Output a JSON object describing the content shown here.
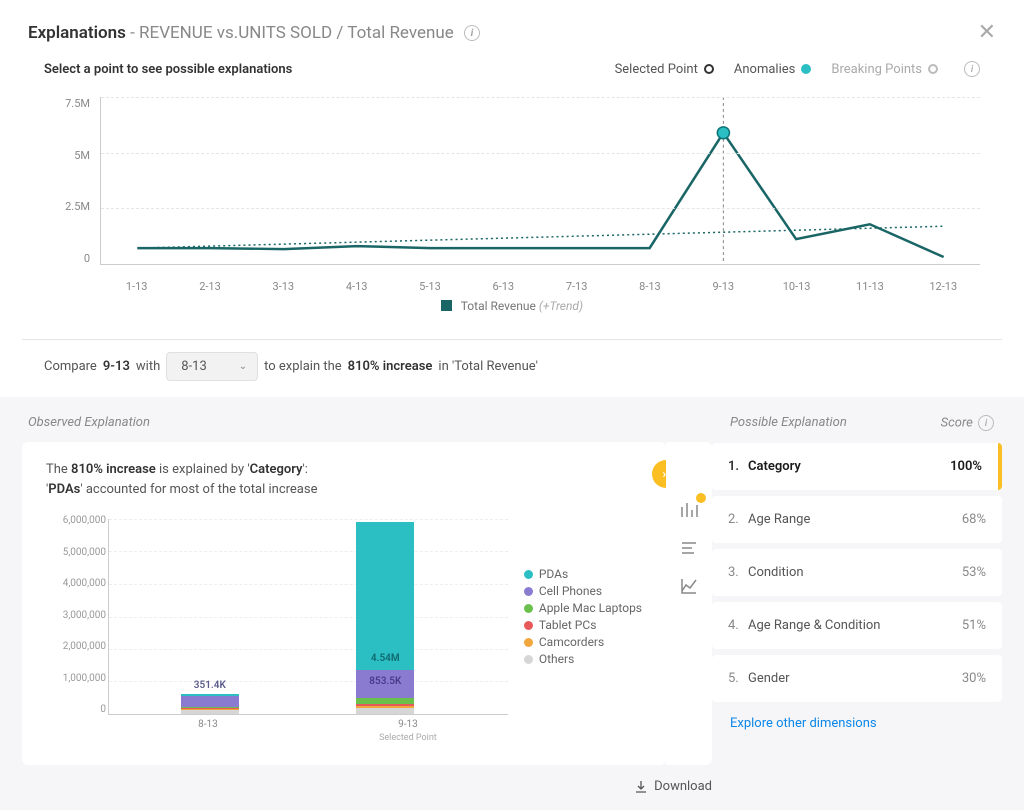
{
  "header": {
    "title_main": "Explanations",
    "title_sub": " - REVENUE vs.UNITS SOLD / Total Revenue"
  },
  "chart": {
    "prompt": "Select a point to see possible explanations",
    "legend": {
      "selected_point": "Selected Point",
      "anomalies": "Anomalies",
      "breaking_points": "Breaking Points"
    },
    "series_legend": "Total Revenue",
    "series_legend_extra": "(+Trend)",
    "y_ticks": [
      "7.5M",
      "5M",
      "2.5M",
      "0"
    ],
    "x_ticks": [
      "1-13",
      "2-13",
      "3-13",
      "4-13",
      "5-13",
      "6-13",
      "7-13",
      "8-13",
      "9-13",
      "10-13",
      "11-13",
      "12-13"
    ]
  },
  "chart_data": [
    {
      "type": "line",
      "title": "Total Revenue (+Trend)",
      "xlabel": "",
      "ylabel": "",
      "ylim": [
        0,
        7500000
      ],
      "categories": [
        "1-13",
        "2-13",
        "3-13",
        "4-13",
        "5-13",
        "6-13",
        "7-13",
        "8-13",
        "9-13",
        "10-13",
        "11-13",
        "12-13"
      ],
      "series": [
        {
          "name": "Total Revenue",
          "values": [
            700000,
            720000,
            680000,
            800000,
            700000,
            720000,
            730000,
            720000,
            5900000,
            1100000,
            1800000,
            300000
          ]
        },
        {
          "name": "Trend",
          "values": [
            700000,
            790000,
            880000,
            970000,
            1060000,
            1150000,
            1240000,
            1330000,
            1420000,
            1510000,
            1600000,
            1700000
          ]
        }
      ],
      "anomaly_index": 8
    },
    {
      "type": "bar",
      "title": "Observed Explanation by Category",
      "xlabel": "",
      "ylabel": "",
      "ylim": [
        0,
        6000000
      ],
      "categories": [
        "8-13",
        "9-13 Selected Point"
      ],
      "series": [
        {
          "name": "PDAs",
          "color": "#2bbfc4",
          "values": [
            60000,
            4540000
          ]
        },
        {
          "name": "Cell Phones",
          "color": "#8a7bd1",
          "values": [
            351400,
            853500
          ]
        },
        {
          "name": "Apple Mac Laptops",
          "color": "#6ac04b",
          "values": [
            40000,
            180000
          ]
        },
        {
          "name": "Tablet PCs",
          "color": "#e85a5a",
          "values": [
            30000,
            70000
          ]
        },
        {
          "name": "Camcorders",
          "color": "#f2a73d",
          "values": [
            30000,
            60000
          ]
        },
        {
          "name": "Others",
          "color": "#d6d6d6",
          "values": [
            130000,
            200000
          ]
        }
      ],
      "labels": {
        "8-13": "351.4K",
        "9-13_top": "4.54M",
        "9-13_mid": "853.5K"
      }
    }
  ],
  "compare": {
    "prefix": "Compare",
    "point": "9-13",
    "with": "with",
    "other_point": "8-13",
    "explain_prefix": "to explain the",
    "increase": "810% increase",
    "in": "in 'Total Revenue'"
  },
  "observed": {
    "header": "Observed Explanation",
    "line1_pre": "The ",
    "line1_bold": "810% increase",
    "line1_mid": " is explained by '",
    "line1_cat": "Category",
    "line1_post": "':",
    "line2_pre": "'",
    "line2_bold": "PDAs",
    "line2_post": "' accounted for most of the total increase",
    "bar_y_ticks": [
      "6,000,000",
      "5,000,000",
      "4,000,000",
      "3,000,000",
      "2,000,000",
      "1,000,000",
      "0"
    ],
    "bar_x_1": "8-13",
    "bar_x_2": "9-13",
    "bar_x_2_sub": "Selected Point",
    "bar_legend": [
      {
        "name": "PDAs",
        "color": "#2bbfc4"
      },
      {
        "name": "Cell Phones",
        "color": "#8a7bd1"
      },
      {
        "name": "Apple Mac Laptops",
        "color": "#6ac04b"
      },
      {
        "name": "Tablet PCs",
        "color": "#e85a5a"
      },
      {
        "name": "Camcorders",
        "color": "#f2a73d"
      },
      {
        "name": "Others",
        "color": "#d6d6d6"
      }
    ],
    "label_813": "351.4K",
    "label_913_top": "4.54M",
    "label_913_mid": "853.5K"
  },
  "possible": {
    "header": "Possible Explanation",
    "score_header": "Score",
    "items": [
      {
        "num": "1.",
        "label": "Category",
        "score": "100%"
      },
      {
        "num": "2.",
        "label": "Age Range",
        "score": "68%"
      },
      {
        "num": "3.",
        "label": "Condition",
        "score": "53%"
      },
      {
        "num": "4.",
        "label": "Age Range & Condition",
        "score": "51%"
      },
      {
        "num": "5.",
        "label": "Gender",
        "score": "30%"
      }
    ]
  },
  "footer": {
    "download": "Download",
    "explore": "Explore other dimensions"
  }
}
